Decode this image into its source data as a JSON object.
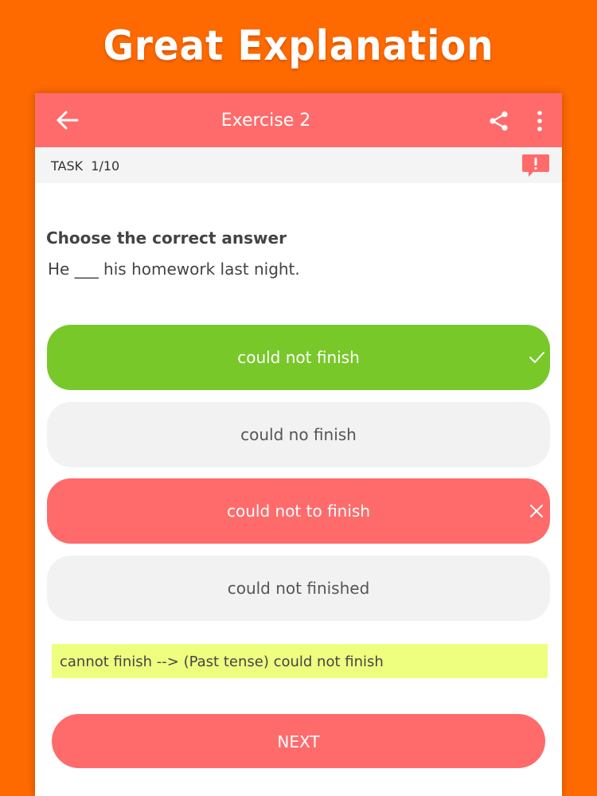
{
  "headline": "Great Explanation",
  "appbar": {
    "title": "Exercise 2",
    "back_icon": "arrow-left-icon",
    "share_icon": "share-icon",
    "more_icon": "more-vertical-icon"
  },
  "task": {
    "label": "TASK",
    "progress": "1/10",
    "report_icon": "report-issue-icon"
  },
  "question": {
    "instruction": "Choose the correct answer",
    "sentence": "He ___ his homework last night."
  },
  "options": [
    {
      "label": "could not finish",
      "state": "correct",
      "icon": "check-icon"
    },
    {
      "label": "could no finish",
      "state": "neutral"
    },
    {
      "label": "could not to finish",
      "state": "wrong",
      "icon": "close-icon"
    },
    {
      "label": "could not finished",
      "state": "neutral"
    }
  ],
  "explanation": "cannot finish --> (Past tense) could not finish",
  "next_label": "NEXT",
  "colors": {
    "background": "#ff6a00",
    "appbar": "#ff6b6b",
    "correct": "#78c82a",
    "wrong": "#ff6b6b",
    "neutral": "#f2f2f2",
    "explanation": "#eeff80"
  }
}
